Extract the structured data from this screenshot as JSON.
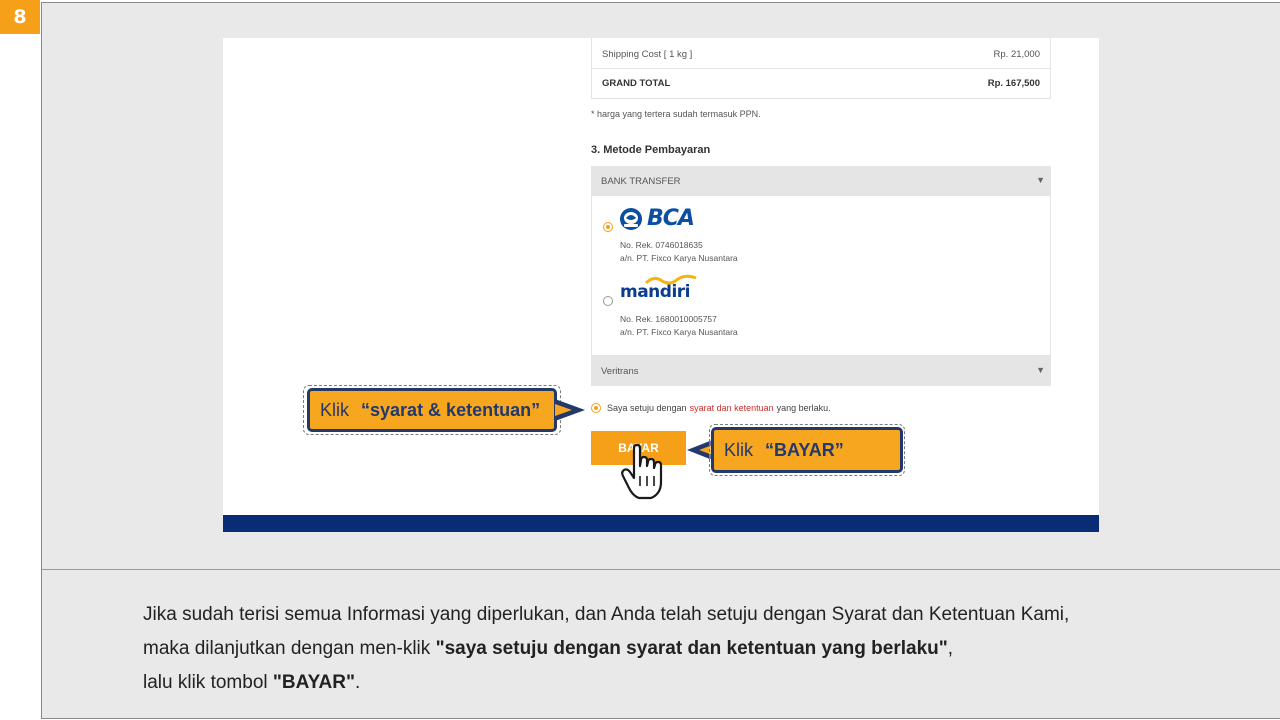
{
  "step_number": "8",
  "summary": {
    "shipping_label": "Shipping Cost [ 1 kg ]",
    "shipping_value": "Rp. 21,000",
    "grand_total_label": "GRAND TOTAL",
    "grand_total_value": "Rp. 167,500"
  },
  "ppn_note": "* harga yang tertera sudah termasuk PPN.",
  "payment": {
    "section_title": "3. Metode Pembayaran",
    "bank_transfer_label": "BANK TRANSFER",
    "veritrans_label": "Veritrans",
    "banks": [
      {
        "logo": "BCA",
        "account": "No. Rek. 0746018635",
        "holder": "a/n. PT. Fixco Karya Nusantara",
        "selected": true
      },
      {
        "logo": "mandiri",
        "account": "No. Rek. 1680010005757",
        "holder": "a/n. PT. Fixco Karya Nusantara",
        "selected": false
      }
    ]
  },
  "agreement": {
    "prefix": "Saya setuju dengan",
    "link": "syarat dan ketentuan",
    "suffix": "yang berlaku."
  },
  "pay_button": "BAYAR",
  "callouts": {
    "terms": {
      "klik": "Klik",
      "target": "“syarat & ketentuan”"
    },
    "pay": {
      "klik": "Klik",
      "target": "“BAYAR”"
    }
  },
  "instructions": {
    "line1": "Jika sudah terisi semua Informasi yang diperlukan, dan Anda telah setuju dengan Syarat dan Ketentuan Kami,",
    "line2_prefix": "maka dilanjutkan dengan men-klik ",
    "line2_bold": "\"saya setuju dengan syarat dan ketentuan yang berlaku\"",
    "line2_suffix": ",",
    "line3_prefix": "lalu klik tombol ",
    "line3_bold": "\"BAYAR\"",
    "line3_suffix": "."
  },
  "colors": {
    "accent": "#f6a01a",
    "navy": "#23386b",
    "footer": "#0a2c74",
    "link": "#c9302c"
  }
}
